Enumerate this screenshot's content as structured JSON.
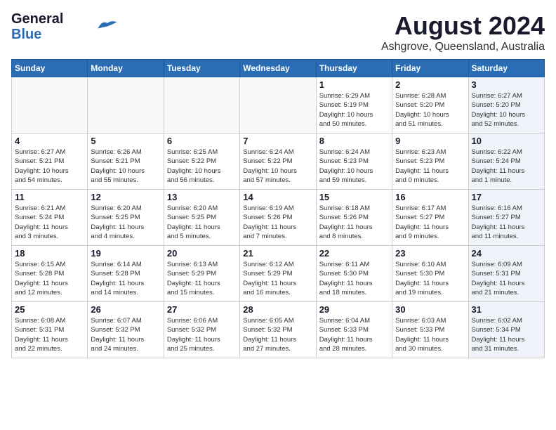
{
  "header": {
    "logo_general": "General",
    "logo_blue": "Blue",
    "month_year": "August 2024",
    "location": "Ashgrove, Queensland, Australia"
  },
  "weekdays": [
    "Sunday",
    "Monday",
    "Tuesday",
    "Wednesday",
    "Thursday",
    "Friday",
    "Saturday"
  ],
  "weeks": [
    [
      {
        "day": "",
        "info": "",
        "empty": true
      },
      {
        "day": "",
        "info": "",
        "empty": true
      },
      {
        "day": "",
        "info": "",
        "empty": true
      },
      {
        "day": "",
        "info": "",
        "empty": true
      },
      {
        "day": "1",
        "info": "Sunrise: 6:29 AM\nSunset: 5:19 PM\nDaylight: 10 hours\nand 50 minutes.",
        "shaded": false
      },
      {
        "day": "2",
        "info": "Sunrise: 6:28 AM\nSunset: 5:20 PM\nDaylight: 10 hours\nand 51 minutes.",
        "shaded": false
      },
      {
        "day": "3",
        "info": "Sunrise: 6:27 AM\nSunset: 5:20 PM\nDaylight: 10 hours\nand 52 minutes.",
        "shaded": true
      }
    ],
    [
      {
        "day": "4",
        "info": "Sunrise: 6:27 AM\nSunset: 5:21 PM\nDaylight: 10 hours\nand 54 minutes.",
        "shaded": false
      },
      {
        "day": "5",
        "info": "Sunrise: 6:26 AM\nSunset: 5:21 PM\nDaylight: 10 hours\nand 55 minutes.",
        "shaded": false
      },
      {
        "day": "6",
        "info": "Sunrise: 6:25 AM\nSunset: 5:22 PM\nDaylight: 10 hours\nand 56 minutes.",
        "shaded": false
      },
      {
        "day": "7",
        "info": "Sunrise: 6:24 AM\nSunset: 5:22 PM\nDaylight: 10 hours\nand 57 minutes.",
        "shaded": false
      },
      {
        "day": "8",
        "info": "Sunrise: 6:24 AM\nSunset: 5:23 PM\nDaylight: 10 hours\nand 59 minutes.",
        "shaded": false
      },
      {
        "day": "9",
        "info": "Sunrise: 6:23 AM\nSunset: 5:23 PM\nDaylight: 11 hours\nand 0 minutes.",
        "shaded": false
      },
      {
        "day": "10",
        "info": "Sunrise: 6:22 AM\nSunset: 5:24 PM\nDaylight: 11 hours\nand 1 minute.",
        "shaded": true
      }
    ],
    [
      {
        "day": "11",
        "info": "Sunrise: 6:21 AM\nSunset: 5:24 PM\nDaylight: 11 hours\nand 3 minutes.",
        "shaded": false
      },
      {
        "day": "12",
        "info": "Sunrise: 6:20 AM\nSunset: 5:25 PM\nDaylight: 11 hours\nand 4 minutes.",
        "shaded": false
      },
      {
        "day": "13",
        "info": "Sunrise: 6:20 AM\nSunset: 5:25 PM\nDaylight: 11 hours\nand 5 minutes.",
        "shaded": false
      },
      {
        "day": "14",
        "info": "Sunrise: 6:19 AM\nSunset: 5:26 PM\nDaylight: 11 hours\nand 7 minutes.",
        "shaded": false
      },
      {
        "day": "15",
        "info": "Sunrise: 6:18 AM\nSunset: 5:26 PM\nDaylight: 11 hours\nand 8 minutes.",
        "shaded": false
      },
      {
        "day": "16",
        "info": "Sunrise: 6:17 AM\nSunset: 5:27 PM\nDaylight: 11 hours\nand 9 minutes.",
        "shaded": false
      },
      {
        "day": "17",
        "info": "Sunrise: 6:16 AM\nSunset: 5:27 PM\nDaylight: 11 hours\nand 11 minutes.",
        "shaded": true
      }
    ],
    [
      {
        "day": "18",
        "info": "Sunrise: 6:15 AM\nSunset: 5:28 PM\nDaylight: 11 hours\nand 12 minutes.",
        "shaded": false
      },
      {
        "day": "19",
        "info": "Sunrise: 6:14 AM\nSunset: 5:28 PM\nDaylight: 11 hours\nand 14 minutes.",
        "shaded": false
      },
      {
        "day": "20",
        "info": "Sunrise: 6:13 AM\nSunset: 5:29 PM\nDaylight: 11 hours\nand 15 minutes.",
        "shaded": false
      },
      {
        "day": "21",
        "info": "Sunrise: 6:12 AM\nSunset: 5:29 PM\nDaylight: 11 hours\nand 16 minutes.",
        "shaded": false
      },
      {
        "day": "22",
        "info": "Sunrise: 6:11 AM\nSunset: 5:30 PM\nDaylight: 11 hours\nand 18 minutes.",
        "shaded": false
      },
      {
        "day": "23",
        "info": "Sunrise: 6:10 AM\nSunset: 5:30 PM\nDaylight: 11 hours\nand 19 minutes.",
        "shaded": false
      },
      {
        "day": "24",
        "info": "Sunrise: 6:09 AM\nSunset: 5:31 PM\nDaylight: 11 hours\nand 21 minutes.",
        "shaded": true
      }
    ],
    [
      {
        "day": "25",
        "info": "Sunrise: 6:08 AM\nSunset: 5:31 PM\nDaylight: 11 hours\nand 22 minutes.",
        "shaded": false
      },
      {
        "day": "26",
        "info": "Sunrise: 6:07 AM\nSunset: 5:32 PM\nDaylight: 11 hours\nand 24 minutes.",
        "shaded": false
      },
      {
        "day": "27",
        "info": "Sunrise: 6:06 AM\nSunset: 5:32 PM\nDaylight: 11 hours\nand 25 minutes.",
        "shaded": false
      },
      {
        "day": "28",
        "info": "Sunrise: 6:05 AM\nSunset: 5:32 PM\nDaylight: 11 hours\nand 27 minutes.",
        "shaded": false
      },
      {
        "day": "29",
        "info": "Sunrise: 6:04 AM\nSunset: 5:33 PM\nDaylight: 11 hours\nand 28 minutes.",
        "shaded": false
      },
      {
        "day": "30",
        "info": "Sunrise: 6:03 AM\nSunset: 5:33 PM\nDaylight: 11 hours\nand 30 minutes.",
        "shaded": false
      },
      {
        "day": "31",
        "info": "Sunrise: 6:02 AM\nSunset: 5:34 PM\nDaylight: 11 hours\nand 31 minutes.",
        "shaded": true
      }
    ]
  ]
}
